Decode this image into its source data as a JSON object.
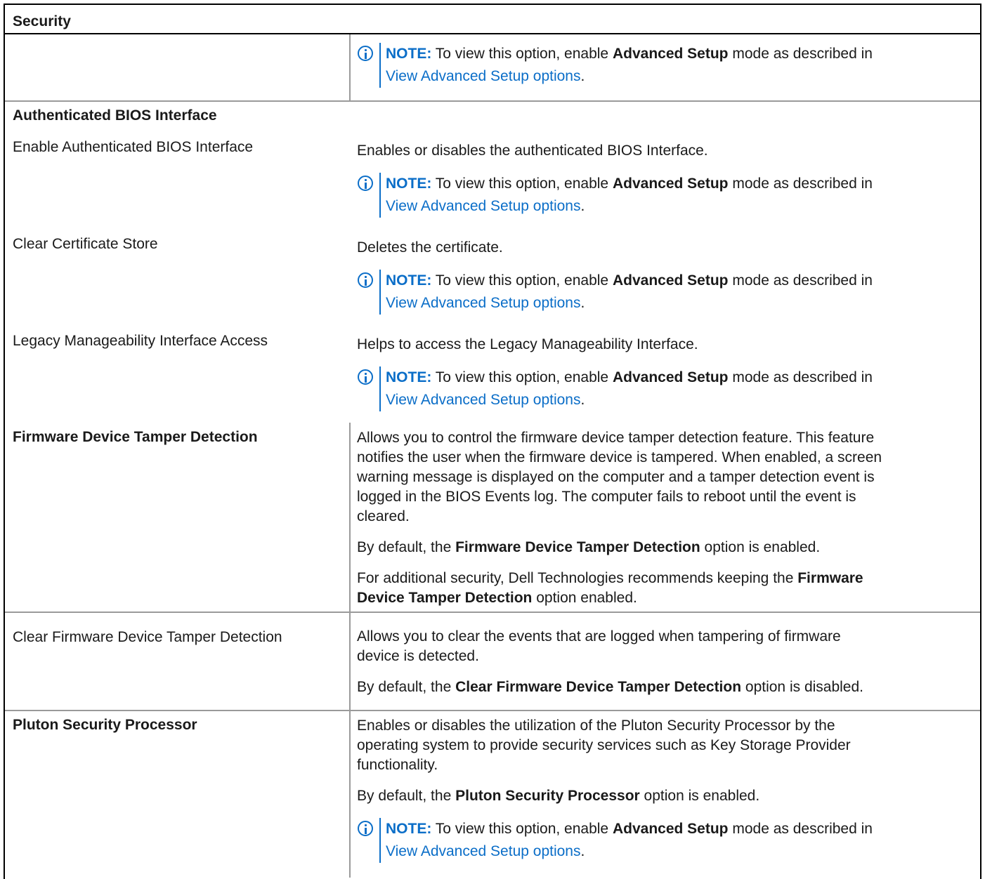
{
  "table": {
    "header": "Security"
  },
  "note": {
    "label": "NOTE:",
    "text_before": "To view this option, enable",
    "emphasis": "Advanced Setup",
    "text_after": "mode as described in",
    "link": "View Advanced Setup options",
    "period": "."
  },
  "rows": {
    "section_authenticated": "Authenticated BIOS Interface",
    "enable_auth": {
      "label": "Enable Authenticated BIOS Interface",
      "desc": "Enables or disables the authenticated BIOS Interface."
    },
    "clear_cert": {
      "label": "Clear Certificate Store",
      "desc": "Deletes the certificate."
    },
    "legacy": {
      "label": "Legacy Manageability Interface Access",
      "desc": "Helps to access the Legacy Manageability Interface."
    },
    "tamper": {
      "label": "Firmware Device Tamper Detection",
      "desc_line1": "Allows you to control the firmware device tamper detection feature. This feature",
      "desc_line2": "notifies the user when the firmware device is tampered. When enabled, a screen",
      "desc_line3": "warning message is displayed on the computer and a tamper detection event is",
      "desc_line4": "logged in the BIOS Events log. The computer fails to reboot until the event is",
      "desc_line5": "cleared.",
      "default_pre": "By default, the",
      "default_bold": "Firmware Device Tamper Detection",
      "default_post": "option is enabled.",
      "rec_pre": "For additional security, Dell Technologies recommends keeping the",
      "rec_bold1": "Firmware",
      "rec_bold2": "Device Tamper Detection",
      "rec_post": "option enabled."
    },
    "clear_tamper": {
      "label": "Clear Firmware Device Tamper Detection",
      "desc_line1": "Allows you to clear the events that are logged when tampering of firmware",
      "desc_line2": "device is detected.",
      "default_pre": "By default, the",
      "default_bold": "Clear Firmware Device Tamper Detection",
      "default_post": "option is disabled."
    },
    "pluton": {
      "label": "Pluton Security Processor",
      "desc_line1": "Enables or disables the utilization of the Pluton Security Processor by the",
      "desc_line2": "operating system to provide security services such as Key Storage Provider",
      "desc_line3": "functionality.",
      "default_pre": "By default, the",
      "default_bold": "Pluton Security Processor",
      "default_post": "option is enabled."
    }
  }
}
